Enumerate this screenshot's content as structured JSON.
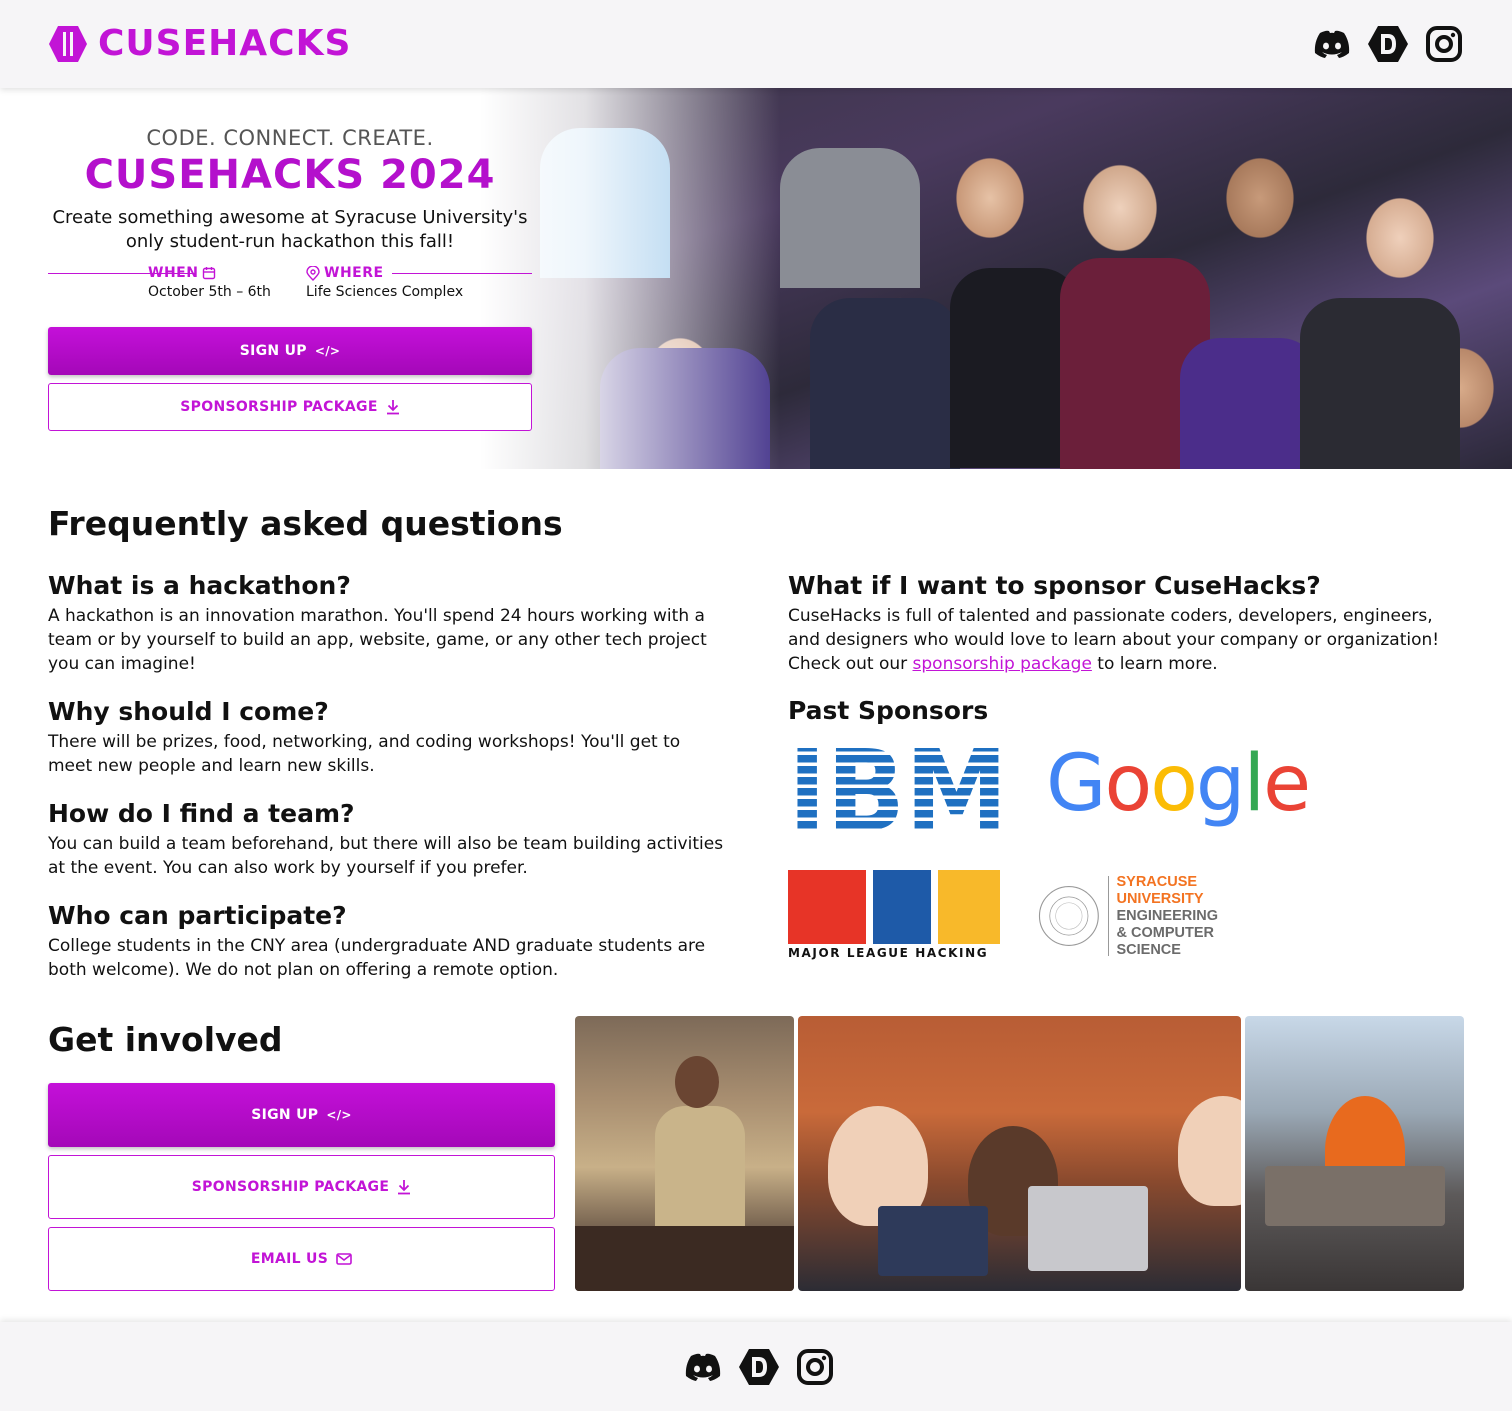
{
  "brand": {
    "name": "CUSEHACKS",
    "color": "#c214d6"
  },
  "header": {
    "socials": [
      "discord-icon",
      "devpost-icon",
      "instagram-icon"
    ]
  },
  "hero": {
    "tagline": "CODE. CONNECT. CREATE.",
    "title": "CUSEHACKS 2024",
    "description": "Create something awesome at Syracuse University's only student-run hackathon this fall!",
    "when_label": "WHEN",
    "when_value": "October 5th – 6th",
    "where_label": "WHERE",
    "where_value": "Life Sciences Complex",
    "signup_label": "SIGN UP",
    "sponsorship_label": "SPONSORSHIP PACKAGE"
  },
  "faq": {
    "title": "Frequently asked questions",
    "left": [
      {
        "q": "What is a hackathon?",
        "a": "A hackathon is an innovation marathon. You'll spend 24 hours working with a team or by yourself to build an app, website, game, or any other tech project you can imagine!"
      },
      {
        "q": "Why should I come?",
        "a": "There will be prizes, food, networking, and coding workshops! You'll get to meet new people and learn new skills."
      },
      {
        "q": "How do I find a team?",
        "a": "You can build a team beforehand, but there will also be team building activities at the event. You can also work by yourself if you prefer."
      },
      {
        "q": "Who can participate?",
        "a": "College students in the CNY area (undergraduate AND graduate students are both welcome). We do not plan on offering a remote option."
      }
    ],
    "sponsor_q": "What if I want to sponsor CuseHacks?",
    "sponsor_a_before": "CuseHacks is full of talented and passionate coders, developers, engineers, and designers who would love to learn about your company or organization! Check out our ",
    "sponsor_a_link": "sponsorship package",
    "sponsor_a_after": " to learn more."
  },
  "sponsors": {
    "title": "Past Sponsors",
    "ibm": "IBM",
    "google": "Google",
    "mlh": "MLH",
    "mlh_sub": "MAJOR LEAGUE HACKING",
    "su_line1": "SYRACUSE",
    "su_line2": "UNIVERSITY",
    "su_line3": "ENGINEERING",
    "su_line4": "& COMPUTER",
    "su_line5": "SCIENCE",
    "su_seal_text": "SYRACUSE UNIVERSITY · FOUNDED A·D· 1870"
  },
  "get_involved": {
    "title": "Get involved",
    "signup_label": "SIGN UP",
    "sponsorship_label": "SPONSORSHIP PACKAGE",
    "email_label": "EMAIL US"
  },
  "footer": {
    "socials": [
      "discord-icon",
      "devpost-icon",
      "instagram-icon"
    ]
  }
}
